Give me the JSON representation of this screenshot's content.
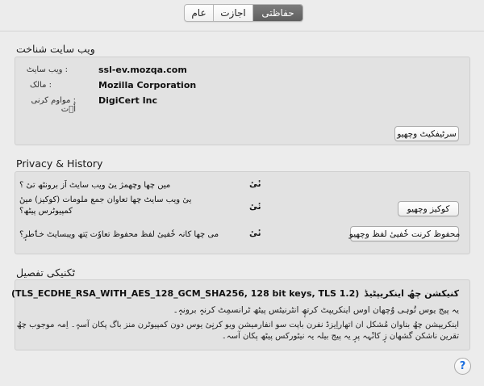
{
  "tabs": [
    {
      "label": "عام",
      "active": false
    },
    {
      "label": "اجازت",
      "active": false
    },
    {
      "label": "حفاظتی",
      "active": true
    }
  ],
  "identity": {
    "title": "ویب سایت شناخت",
    "website_label": ": ویب سایٹ",
    "website_value": "ssl-ev.mozqa.com",
    "owner_label": ": مالک",
    "owner_value": "Mozilla Corporation",
    "verifier_label": ": مواوم کرنی اٗ٘ت",
    "verifier_value": "DigiCert Inc",
    "view_cert_button": "سرٹیفکیٹ وچھیو"
  },
  "privacy": {
    "title": "Privacy & History",
    "q1": "میں چھا وچھمژ ییٔ ویب سایٹ اَز برونٹھ تیٔ ؟",
    "a1": "نٔیٔ",
    "q2": "ییٔ ویب سایٹ چھا تعاوان جمع ملومات (کوکیز) مینٔ کمپیوٹرس پیٹھ؟",
    "a2": "نٔیٔ",
    "cookies_button": "کوکیز وچھیو",
    "q3": "می چھا کانہ خٗفییٔ لفظ محفوظ تعاوٗت یَتھ ویبسایٹ خٲطرٕ؟",
    "a3": "نٔیٔ",
    "passwords_button": "محفوظ کرنت خٗفییٔ لفظ وچھیو"
  },
  "technical": {
    "title": "ٹکنیکی تفصیل",
    "encryption_label": "کنیکشن چھُ اینکریپٹیڈ",
    "encryption_detail": "(TLS_ECDHE_RSA_WITH_AES_128_GCM_SHA256, 128 bit keys, TLS 1.2)",
    "line1": "یہ پیج یوس تُوہی وُچھان اوس اینکریپٹ کرتھٕ انٹرنیٹس پیٹھ ٹرانسمِٹ کرنہٕ برونہٕ۔",
    "line2": "اینکریپشن چھُ بناوان مُشکل ان اتھاراِیزڈ نفرن باپت سو انفارمیشن ویو کرنٕیٔ یوس دون کمپیوٹرن منز باگ پکان آسہٕ۔ اِمہ موجوب چھُ",
    "line3": "تقرین  ناشکن گشھان زٕ کانْہہ پرٕ یہ پیج بیلہ یہ نیٹورکس پیٹھ پکان آسہ۔"
  },
  "help_button": "?"
}
